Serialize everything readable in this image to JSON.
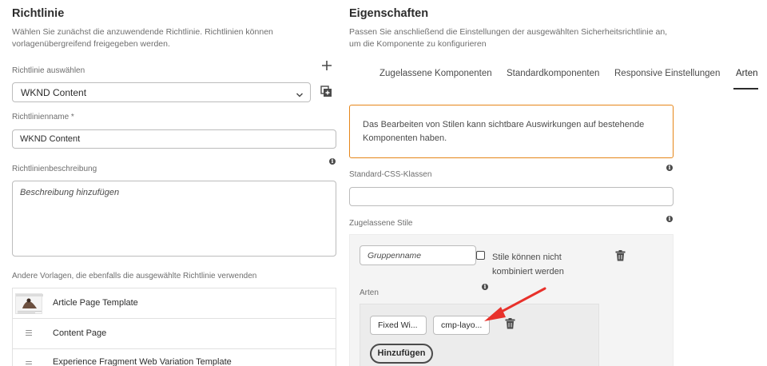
{
  "left": {
    "title": "Richtlinie",
    "description": "Wählen Sie zunächst die anzuwendende Richtlinie. Richtlinien können vorlagenübergreifend freigegeben werden.",
    "select_label": "Richtlinie auswählen",
    "select_value": "WKND Content",
    "name_label": "Richtlinienname *",
    "name_value": "WKND Content",
    "desc_label": "Richtlinienbeschreibung",
    "desc_placeholder": "Beschreibung hinzufügen",
    "others_label": "Andere Vorlagen, die ebenfalls die ausgewählte Richtlinie verwenden",
    "templates": [
      {
        "name": "Article Page Template",
        "icon": "thumbnail"
      },
      {
        "name": "Content Page",
        "icon": "document-icon"
      },
      {
        "name": "Experience Fragment Web Variation Template",
        "icon": "document-icon"
      }
    ]
  },
  "right": {
    "title": "Eigenschaften",
    "description": "Passen Sie anschließend die Einstellungen der ausgewählten Sicherheitsrichtlinie an, um die Komponente zu konfigurieren",
    "tabs": [
      "Zugelassene Komponenten",
      "Standardkomponenten",
      "Responsive Einstellungen",
      "Arten"
    ],
    "active_tab": "Arten",
    "warning": "Das Bearbeiten von Stilen kann sichtbare Auswirkungen auf bestehende Komponenten haben.",
    "css_label": "Standard-CSS-Klassen",
    "css_value": "",
    "allowed_label": "Zugelassene Stile",
    "group_placeholder": "Gruppenname",
    "combine_label_1": "Stile können nicht",
    "combine_label_2": "kombiniert werden",
    "styles_label": "Arten",
    "style_name": "Fixed Wi...",
    "style_class": "cmp-layo...",
    "add_button": "Hinzufügen"
  },
  "colors": {
    "warning_border": "#e68619",
    "arrow": "#e8312b",
    "tab_active_underline": "#2c2c2c"
  }
}
